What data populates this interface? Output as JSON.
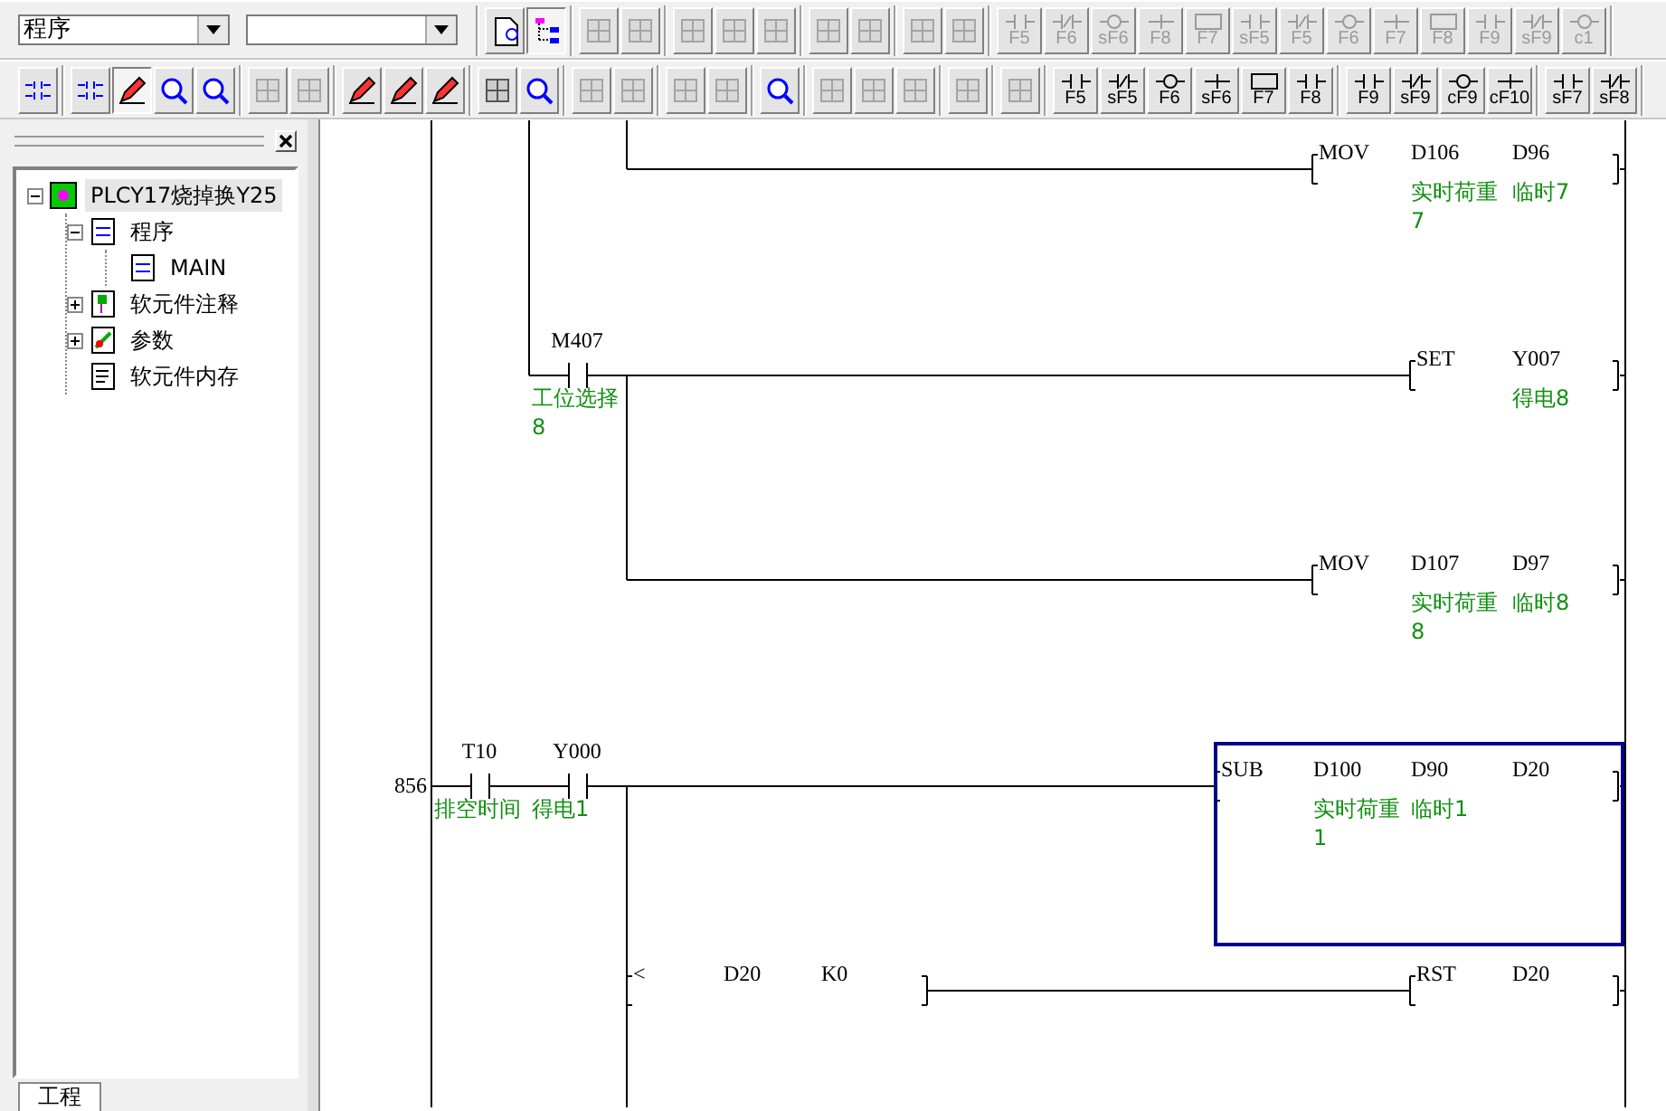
{
  "toolbars": [
    {
      "groups": [
        [
          {
            "kind": "dropdown",
            "value": "程序"
          },
          {
            "kind": "dropdown"
          }
        ],
        [
          {
            "kind": "icon",
            "pressed": false,
            "disabled": false
          },
          {
            "kind": "icon",
            "pressed": true,
            "disabled": false
          }
        ],
        [
          {
            "kind": "icon",
            "pressed": false,
            "disabled": true
          },
          {
            "kind": "icon",
            "pressed": false,
            "disabled": true
          }
        ],
        [
          {
            "kind": "icon",
            "pressed": false,
            "disabled": true
          },
          {
            "kind": "icon",
            "pressed": false,
            "disabled": true
          },
          {
            "kind": "icon",
            "pressed": false,
            "disabled": true
          }
        ],
        [
          {
            "kind": "icon",
            "pressed": false,
            "disabled": true
          },
          {
            "kind": "icon",
            "pressed": false,
            "disabled": true
          }
        ],
        [
          {
            "kind": "icon",
            "pressed": false,
            "disabled": true
          },
          {
            "kind": "icon",
            "pressed": false,
            "disabled": true
          }
        ],
        [
          {
            "kind": "key",
            "label": "F5",
            "pressed": false,
            "disabled": true
          },
          {
            "kind": "key",
            "label": "F6",
            "pressed": false,
            "disabled": true
          },
          {
            "kind": "key",
            "label": "sF6",
            "pressed": false,
            "disabled": true
          },
          {
            "kind": "key",
            "label": "F8",
            "pressed": false,
            "disabled": true
          },
          {
            "kind": "key",
            "label": "F7",
            "pressed": false,
            "disabled": true
          },
          {
            "kind": "key",
            "label": "sF5",
            "pressed": false,
            "disabled": true
          },
          {
            "kind": "key",
            "label": "F5",
            "pressed": false,
            "disabled": true
          },
          {
            "kind": "key",
            "label": "F6",
            "pressed": false,
            "disabled": true
          },
          {
            "kind": "key",
            "label": "F7",
            "pressed": false,
            "disabled": true
          },
          {
            "kind": "key",
            "label": "F8",
            "pressed": false,
            "disabled": true
          },
          {
            "kind": "key",
            "label": "F9",
            "pressed": false,
            "disabled": true
          },
          {
            "kind": "key",
            "label": "sF9",
            "pressed": false,
            "disabled": true
          },
          {
            "kind": "key",
            "label": "c1",
            "pressed": false,
            "disabled": true
          }
        ]
      ]
    },
    {
      "groups": [
        [
          {
            "kind": "icon",
            "pressed": false,
            "disabled": false
          }
        ],
        [
          {
            "kind": "icon",
            "pressed": false,
            "disabled": false
          },
          {
            "kind": "icon",
            "pressed": true,
            "disabled": false
          },
          {
            "kind": "icon",
            "pressed": false,
            "disabled": false
          },
          {
            "kind": "icon",
            "pressed": false,
            "disabled": false
          }
        ],
        [
          {
            "kind": "icon",
            "pressed": false,
            "disabled": true
          },
          {
            "kind": "icon",
            "pressed": false,
            "disabled": true
          }
        ],
        [
          {
            "kind": "icon",
            "pressed": false,
            "disabled": false
          },
          {
            "kind": "icon",
            "pressed": false,
            "disabled": false
          },
          {
            "kind": "icon",
            "pressed": false,
            "disabled": false
          }
        ],
        [
          {
            "kind": "icon",
            "pressed": false,
            "disabled": false
          },
          {
            "kind": "icon",
            "pressed": false,
            "disabled": false
          }
        ],
        [
          {
            "kind": "icon",
            "pressed": false,
            "disabled": true
          },
          {
            "kind": "icon",
            "pressed": false,
            "disabled": true
          }
        ],
        [
          {
            "kind": "icon",
            "pressed": false,
            "disabled": true
          },
          {
            "kind": "icon",
            "pressed": false,
            "disabled": true
          }
        ],
        [
          {
            "kind": "icon",
            "pressed": false,
            "disabled": false
          }
        ],
        [
          {
            "kind": "icon",
            "pressed": false,
            "disabled": true
          },
          {
            "kind": "icon",
            "pressed": false,
            "disabled": true
          },
          {
            "kind": "icon",
            "pressed": false,
            "disabled": true
          }
        ],
        [
          {
            "kind": "icon",
            "pressed": false,
            "disabled": true
          }
        ],
        [
          {
            "kind": "icon",
            "pressed": false,
            "disabled": true
          }
        ],
        [
          {
            "kind": "key",
            "label": "F5",
            "pressed": false,
            "disabled": false
          },
          {
            "kind": "key",
            "label": "sF5",
            "pressed": false,
            "disabled": false
          },
          {
            "kind": "key",
            "label": "F6",
            "pressed": false,
            "disabled": false
          },
          {
            "kind": "key",
            "label": "sF6",
            "pressed": false,
            "disabled": false
          },
          {
            "kind": "key",
            "label": "F7",
            "pressed": false,
            "disabled": false
          },
          {
            "kind": "key",
            "label": "F8",
            "pressed": false,
            "disabled": false
          }
        ],
        [
          {
            "kind": "key",
            "label": "F9",
            "pressed": false,
            "disabled": false
          },
          {
            "kind": "key",
            "label": "sF9",
            "pressed": false,
            "disabled": false
          },
          {
            "kind": "key",
            "label": "cF9",
            "pressed": false,
            "disabled": false
          },
          {
            "kind": "key",
            "label": "cF10",
            "pressed": false,
            "disabled": false
          }
        ],
        [
          {
            "kind": "key",
            "label": "sF7",
            "pressed": false,
            "disabled": false
          },
          {
            "kind": "key",
            "label": "sF8",
            "pressed": false,
            "disabled": false
          }
        ]
      ]
    }
  ],
  "project_panel": {
    "tree": [
      {
        "kind": "project",
        "label": "PLCY17烧掉换Y25",
        "expanded": true,
        "selected": true,
        "children": [
          {
            "kind": "program",
            "label": "程序",
            "expanded": true,
            "selected": false,
            "children": [
              {
                "kind": "main",
                "label": "MAIN",
                "selected": false
              }
            ]
          },
          {
            "kind": "comment",
            "label": "软元件注释",
            "expanded": false,
            "selected": false
          },
          {
            "kind": "param",
            "label": "参数",
            "expanded": false,
            "selected": false
          },
          {
            "kind": "memory",
            "label": "软元件内存",
            "selected": false
          }
        ]
      }
    ],
    "tab": "工程"
  },
  "ladder": {
    "rows": [
      {
        "kind": "branch",
        "selected": false,
        "contacts": [],
        "instruction": {
          "op": "MOV",
          "operands": [
            {
              "device": "D106",
              "comment": "实时荷重7"
            },
            {
              "device": "D96",
              "comment": "临时7"
            }
          ]
        }
      },
      {
        "kind": "parallel",
        "selected": false,
        "contacts": [
          {
            "kind": "contact",
            "device": "M407",
            "comment": "工位选择8"
          }
        ],
        "instruction": {
          "op": "SET",
          "operands": [
            {
              "device": "Y007",
              "comment": "得电8"
            }
          ]
        }
      },
      {
        "kind": "branch",
        "selected": false,
        "contacts": [],
        "instruction": {
          "op": "MOV",
          "operands": [
            {
              "device": "D107",
              "comment": "实时荷重8"
            },
            {
              "device": "D97",
              "comment": "临时8"
            }
          ]
        }
      },
      {
        "kind": "rung",
        "step": "856",
        "selected": true,
        "contacts": [
          {
            "kind": "contact",
            "device": "T10",
            "comment": "排空时间"
          },
          {
            "kind": "contact",
            "device": "Y000",
            "comment": "得电1"
          }
        ],
        "instruction": {
          "op": "SUB",
          "operands": [
            {
              "device": "D100",
              "comment": "实时荷重1"
            },
            {
              "device": "D90",
              "comment": "临时1"
            },
            {
              "device": "D20"
            }
          ]
        }
      },
      {
        "kind": "branch",
        "selected": false,
        "contacts": [
          {
            "kind": "compare",
            "op": "<",
            "operands": [
              "D20",
              "K0"
            ]
          }
        ],
        "instruction": {
          "op": "RST",
          "operands": [
            {
              "device": "D20"
            }
          ]
        }
      }
    ]
  }
}
